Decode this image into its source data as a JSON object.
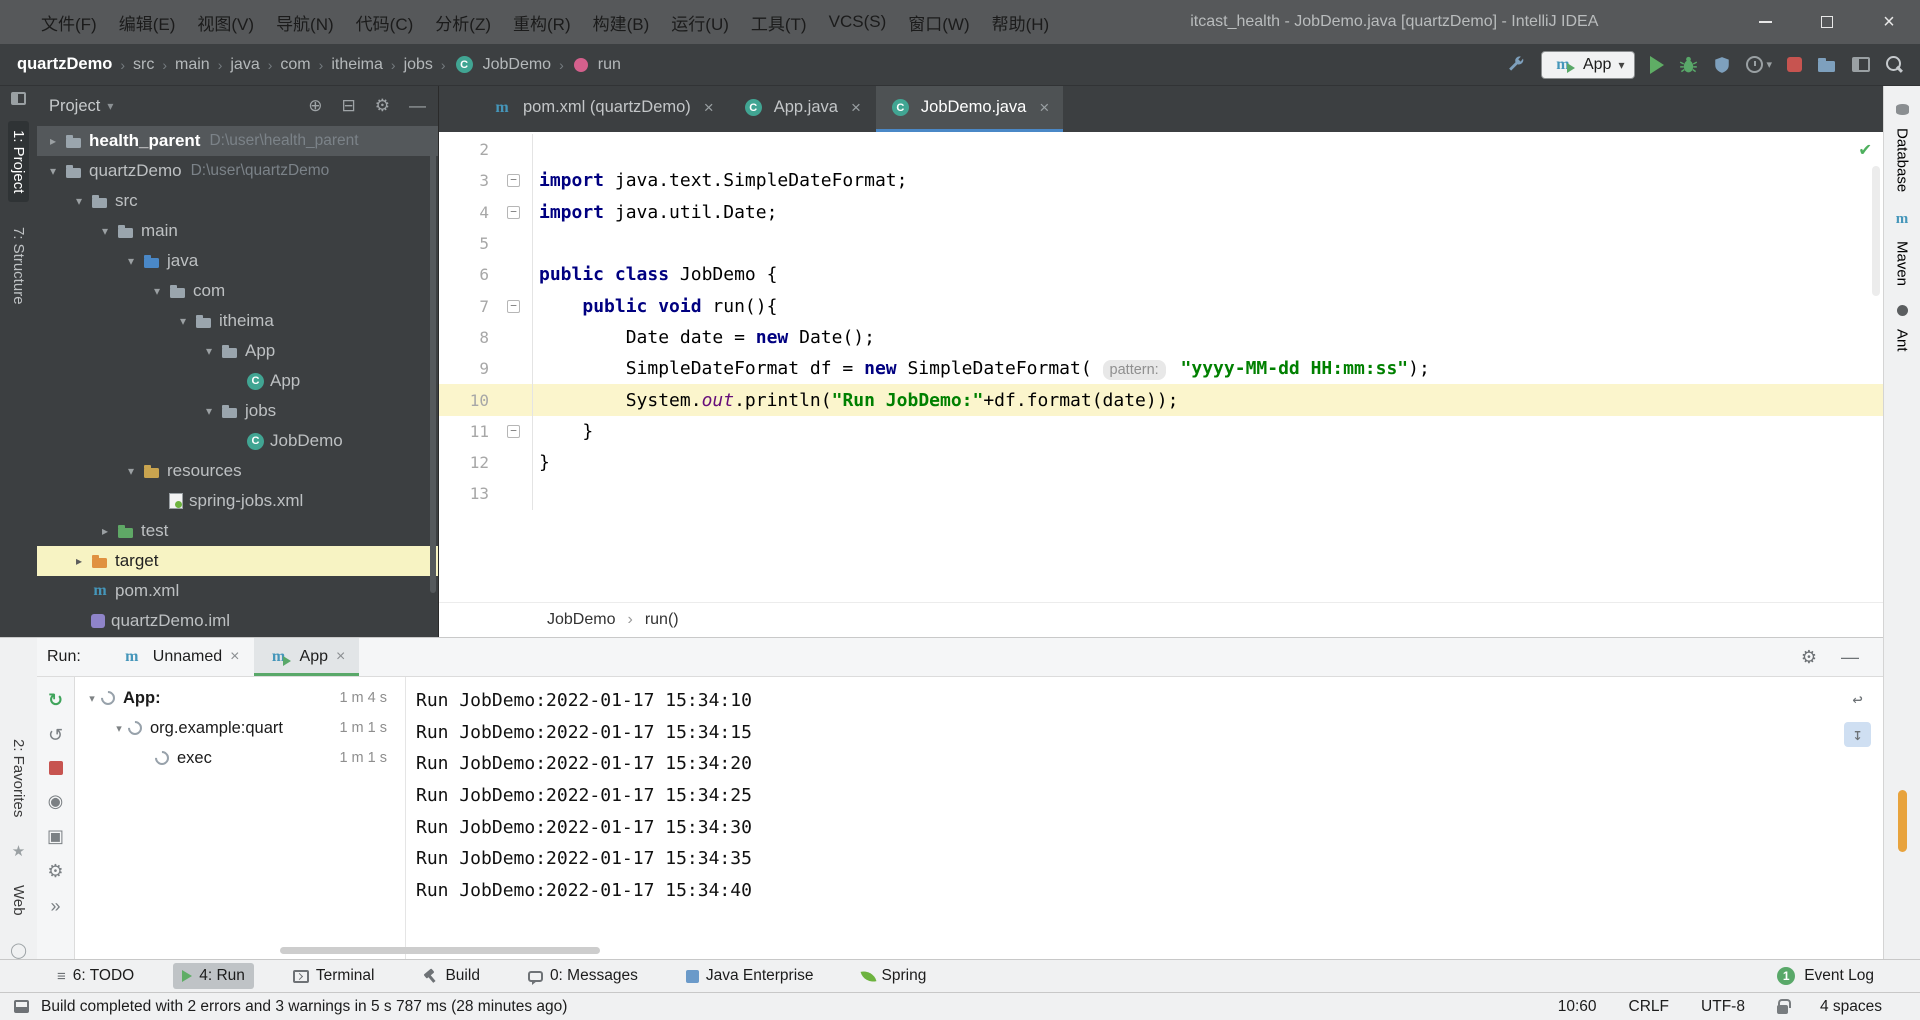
{
  "titlebar": {
    "menus": [
      "文件(F)",
      "编辑(E)",
      "视图(V)",
      "导航(N)",
      "代码(C)",
      "分析(Z)",
      "重构(R)",
      "构建(B)",
      "运行(U)",
      "工具(T)",
      "VCS(S)",
      "窗口(W)",
      "帮助(H)"
    ],
    "title": "itcast_health - JobDemo.java [quartzDemo] - IntelliJ IDEA"
  },
  "navbar": {
    "crumbs": [
      {
        "label": "quartzDemo",
        "bold": true
      },
      {
        "label": "src"
      },
      {
        "label": "main"
      },
      {
        "label": "java"
      },
      {
        "label": "com"
      },
      {
        "label": "itheima"
      },
      {
        "label": "jobs"
      },
      {
        "label": "JobDemo",
        "icon": "class"
      },
      {
        "label": "run",
        "icon": "method"
      }
    ],
    "run_config": "App"
  },
  "left_strip": {
    "top": [
      {
        "label": "1: Project",
        "active": true
      },
      {
        "label": "7: Structure",
        "active": false
      }
    ],
    "bottom": [
      {
        "label": "2: Favorites",
        "icon": "star"
      },
      {
        "label": "Web",
        "icon": "globe"
      }
    ]
  },
  "right_strip": {
    "items": [
      {
        "label": "Database",
        "icon": "database"
      },
      {
        "label": "Maven",
        "icon": "maven"
      },
      {
        "label": "Ant",
        "icon": "ant"
      }
    ]
  },
  "project": {
    "header": "Project",
    "tree": [
      {
        "level": 0,
        "arrow": "closed",
        "icon": "folder",
        "label": "health_parent",
        "path": "D:\\user\\health_parent",
        "sel": true
      },
      {
        "level": 0,
        "arrow": "open",
        "icon": "folder",
        "label": "quartzDemo",
        "path": "D:\\user\\quartzDemo"
      },
      {
        "level": 1,
        "arrow": "open",
        "icon": "folder",
        "label": "src"
      },
      {
        "level": 2,
        "arrow": "open",
        "icon": "folder",
        "label": "main"
      },
      {
        "level": 3,
        "arrow": "open",
        "icon": "folder-src",
        "label": "java"
      },
      {
        "level": 4,
        "arrow": "open",
        "icon": "package",
        "label": "com"
      },
      {
        "level": 5,
        "arrow": "open",
        "icon": "package",
        "label": "itheima"
      },
      {
        "level": 6,
        "arrow": "open",
        "icon": "package",
        "label": "App"
      },
      {
        "level": 7,
        "arrow": "none",
        "icon": "class",
        "label": "App"
      },
      {
        "level": 6,
        "arrow": "open",
        "icon": "package",
        "label": "jobs"
      },
      {
        "level": 7,
        "arrow": "none",
        "icon": "class",
        "label": "JobDemo"
      },
      {
        "level": 3,
        "arrow": "open",
        "icon": "folder-res",
        "label": "resources"
      },
      {
        "level": 4,
        "arrow": "none",
        "icon": "xml",
        "label": "spring-jobs.xml"
      },
      {
        "level": 2,
        "arrow": "closed",
        "icon": "folder-test",
        "label": "test"
      },
      {
        "level": 1,
        "arrow": "closed",
        "icon": "folder-excluded",
        "label": "target",
        "hl": true
      },
      {
        "level": 1,
        "arrow": "none",
        "icon": "maven",
        "label": "pom.xml"
      },
      {
        "level": 1,
        "arrow": "none",
        "icon": "iml",
        "label": "quartzDemo.iml"
      }
    ]
  },
  "editor": {
    "tabs": [
      {
        "label": "pom.xml (quartzDemo)",
        "icon": "maven",
        "active": false
      },
      {
        "label": "App.java",
        "icon": "class",
        "active": false
      },
      {
        "label": "JobDemo.java",
        "icon": "class",
        "active": true
      }
    ],
    "lines": [
      {
        "n": "2",
        "seg": []
      },
      {
        "n": "3",
        "fold": true,
        "seg": [
          {
            "t": "import ",
            "c": "kw"
          },
          {
            "t": "java.text.SimpleDateFormat;",
            "c": "pl"
          }
        ]
      },
      {
        "n": "4",
        "fold": true,
        "seg": [
          {
            "t": "import ",
            "c": "kw"
          },
          {
            "t": "java.util.Date;",
            "c": "pl"
          }
        ]
      },
      {
        "n": "5",
        "seg": []
      },
      {
        "n": "6",
        "seg": [
          {
            "t": "public class ",
            "c": "kw"
          },
          {
            "t": "JobDemo {",
            "c": "pl"
          }
        ]
      },
      {
        "n": "7",
        "fold": true,
        "seg": [
          {
            "t": "    ",
            "c": "pl"
          },
          {
            "t": "public void ",
            "c": "kw"
          },
          {
            "t": "run(){",
            "c": "pl"
          }
        ]
      },
      {
        "n": "8",
        "seg": [
          {
            "t": "        Date date = ",
            "c": "pl"
          },
          {
            "t": "new",
            "c": "kw"
          },
          {
            "t": " Date();",
            "c": "pl"
          }
        ]
      },
      {
        "n": "9",
        "seg": [
          {
            "t": "        SimpleDateFormat df = ",
            "c": "pl"
          },
          {
            "t": "new",
            "c": "kw"
          },
          {
            "t": " SimpleDateFormat( ",
            "c": "pl"
          },
          {
            "t": "pattern:",
            "c": "hint"
          },
          {
            "t": " ",
            "c": "pl"
          },
          {
            "t": "\"yyyy-MM-dd HH:mm:ss\"",
            "c": "str"
          },
          {
            "t": ");",
            "c": "pl"
          }
        ]
      },
      {
        "n": "10",
        "current": true,
        "seg": [
          {
            "t": "        System.",
            "c": "pl"
          },
          {
            "t": "out",
            "c": "fld"
          },
          {
            "t": ".println(",
            "c": "pl"
          },
          {
            "t": "\"Run JobDemo:\"",
            "c": "str"
          },
          {
            "t": "+df.format(date));",
            "c": "pl"
          }
        ]
      },
      {
        "n": "11",
        "fold": true,
        "seg": [
          {
            "t": "    }",
            "c": "pl"
          }
        ]
      },
      {
        "n": "12",
        "seg": [
          {
            "t": "}",
            "c": "pl"
          }
        ]
      },
      {
        "n": "13",
        "seg": []
      }
    ],
    "breadcrumbs": [
      "JobDemo",
      "run()"
    ]
  },
  "run_panel": {
    "label": "Run:",
    "tabs": [
      {
        "label": "Unnamed",
        "icon": "maven",
        "active": false
      },
      {
        "label": "App",
        "icon": "maven-run",
        "active": true
      }
    ],
    "tree": [
      {
        "level": 0,
        "arrow": true,
        "label": "App:",
        "bold": true,
        "time": "1 m 4 s"
      },
      {
        "level": 1,
        "arrow": true,
        "label": "org.example:quart",
        "bold": false,
        "time": "1 m 1 s"
      },
      {
        "level": 2,
        "arrow": false,
        "label": "exec",
        "bold": false,
        "time": "1 m 1 s"
      }
    ],
    "console": [
      "Run JobDemo:2022-01-17 15:34:10",
      "Run JobDemo:2022-01-17 15:34:15",
      "Run JobDemo:2022-01-17 15:34:20",
      "Run JobDemo:2022-01-17 15:34:25",
      "Run JobDemo:2022-01-17 15:34:30",
      "Run JobDemo:2022-01-17 15:34:35",
      "Run JobDemo:2022-01-17 15:34:40"
    ]
  },
  "bottom_bar": {
    "left": [
      {
        "label": "6: TODO",
        "icon": "todo",
        "active": false
      },
      {
        "label": "4: Run",
        "icon": "run",
        "active": true
      },
      {
        "label": "Terminal",
        "icon": "terminal",
        "active": false
      },
      {
        "label": "Build",
        "icon": "build",
        "active": false
      },
      {
        "label": "0: Messages",
        "icon": "messages",
        "active": false
      },
      {
        "label": "Java Enterprise",
        "icon": "javaee",
        "active": false
      },
      {
        "label": "Spring",
        "icon": "spring",
        "active": false
      }
    ],
    "right": {
      "badge": "1",
      "label": "Event Log"
    }
  },
  "status_bar": {
    "message": "Build completed with 2 errors and 3 warnings in 5 s 787 ms (28 minutes ago)",
    "items": [
      "10:60",
      "CRLF",
      "UTF-8",
      {
        "icon": "lock"
      },
      "4 spaces"
    ]
  },
  "icons": {
    "caret_down": "▾",
    "arrow_open": "▾",
    "arrow_closed": "▸",
    "close": "×",
    "gear": "⚙",
    "locate": "⊕",
    "collapse_all": "⊟",
    "hide": "—",
    "check": "✔",
    "rerun": "↻",
    "rerun_failed": "↺",
    "show_passed": "◉",
    "snapshot": "▣",
    "more": "»",
    "soft_wrap": "↩",
    "scroll_end": "↧",
    "todo": "≡",
    "star": "★",
    "globe": "◯",
    "crumb_sep": "›",
    "fold": "−",
    "maven_m": "m"
  }
}
